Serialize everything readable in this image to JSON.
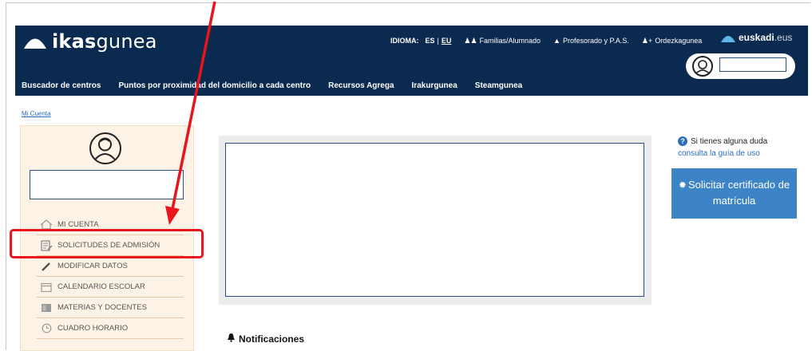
{
  "header": {
    "logo_bold": "ikas",
    "logo_light": "gunea",
    "language_label": "IDIOMA:",
    "lang_es": "ES",
    "lang_eu": "EU",
    "top_links": [
      {
        "label": "Familias/Alumnado",
        "icon": "users-icon"
      },
      {
        "label": "Profesorado y P.A.S.",
        "icon": "graduation-cap-icon"
      },
      {
        "label": "Ordezkagunea",
        "icon": "user-plus-icon"
      }
    ],
    "euskadi_bold": "euskadi",
    "euskadi_domain": ".eus",
    "main_nav": [
      "Buscador de centros",
      "Puntos por proximidad del domicilio a cada centro",
      "Recursos Agrega",
      "Irakurgunea",
      "Steamgunea"
    ]
  },
  "breadcrumb": "Mi Cuenta",
  "sidebar": {
    "menu": [
      {
        "label": "MI CUENTA",
        "icon": "home-icon"
      },
      {
        "label": "SOLICITUDES DE ADMISIÓN",
        "icon": "document-edit-icon"
      },
      {
        "label": "MODIFICAR DATOS",
        "icon": "pencil-icon"
      },
      {
        "label": "CALENDARIO ESCOLAR",
        "icon": "calendar-icon"
      },
      {
        "label": "MATERIAS Y DOCENTES",
        "icon": "book-icon"
      },
      {
        "label": "CUADRO HORARIO",
        "icon": "clock-icon"
      }
    ]
  },
  "main": {
    "notifications_title": "Notificaciones"
  },
  "help": {
    "text": "Si tienes alguna duda",
    "link": "consulta la guía de uso"
  },
  "certificate_button": "Solicitar certificado de matrícula",
  "colors": {
    "header_bg": "#0b2a4f",
    "sidebar_bg": "#fdf2e6",
    "highlight": "#e8151b",
    "button_bg": "#3c84c6",
    "link": "#2a6ebb"
  }
}
